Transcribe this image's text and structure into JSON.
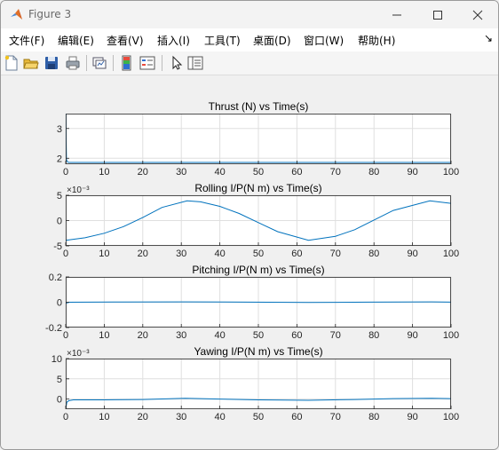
{
  "window": {
    "title": "Figure 3",
    "buttons": {
      "minimize": "minimize",
      "maximize": "maximize",
      "close": "close"
    }
  },
  "menu": [
    {
      "label": "文件(F)"
    },
    {
      "label": "编辑(E)"
    },
    {
      "label": "查看(V)"
    },
    {
      "label": "插入(I)"
    },
    {
      "label": "工具(T)"
    },
    {
      "label": "桌面(D)"
    },
    {
      "label": "窗口(W)"
    },
    {
      "label": "帮助(H)"
    }
  ],
  "menu_overflow_icon": "dock-arrow-icon",
  "toolbar": [
    {
      "icon": "new-figure-icon"
    },
    {
      "icon": "open-file-icon"
    },
    {
      "icon": "save-icon"
    },
    {
      "icon": "print-icon"
    },
    {
      "icon": "link-plot-icon"
    },
    {
      "icon": "insert-colorbar-icon"
    },
    {
      "icon": "insert-legend-icon"
    },
    {
      "icon": "edit-plot-pointer-icon"
    },
    {
      "icon": "property-inspector-icon"
    }
  ],
  "colors": {
    "line": "#0072bd",
    "grid": "#dfdfdf",
    "axes": "#262626"
  },
  "chart_data": [
    {
      "type": "line",
      "title": "Thrust (N) vs Time(s)",
      "xlabel": "",
      "ylabel": "",
      "xlim": [
        0,
        100
      ],
      "ylim": [
        1.8,
        3.5
      ],
      "xticks": [
        "0",
        "10",
        "20",
        "30",
        "40",
        "50",
        "60",
        "70",
        "80",
        "90",
        "100"
      ],
      "yticks": [
        "2",
        "3"
      ],
      "exponent_label": "",
      "grid": true,
      "x": [
        0,
        0.2,
        0.5,
        1,
        100
      ],
      "y": [
        3.5,
        1.95,
        1.87,
        1.86,
        1.86
      ]
    },
    {
      "type": "line",
      "title": "Rolling I/P(N m) vs Time(s)",
      "xlabel": "",
      "ylabel": "",
      "xlim": [
        0,
        100
      ],
      "ylim": [
        -0.005,
        0.005
      ],
      "xticks": [
        "0",
        "10",
        "20",
        "30",
        "40",
        "50",
        "60",
        "70",
        "80",
        "90",
        "100"
      ],
      "yticks": [
        "-5",
        "0",
        "5"
      ],
      "exponent_label": "×10⁻³",
      "grid": true,
      "x": [
        0,
        5,
        10,
        15,
        20,
        25,
        31.5,
        35,
        40,
        45,
        50,
        55,
        63,
        70,
        75,
        80,
        85,
        94.5,
        100
      ],
      "y": [
        -0.0039,
        -0.0034,
        -0.0025,
        -0.0012,
        0.0006,
        0.0026,
        0.0039,
        0.0037,
        0.0028,
        0.0014,
        -0.0004,
        -0.0022,
        -0.0039,
        -0.0031,
        -0.0018,
        0.0001,
        0.002,
        0.0039,
        0.0034
      ]
    },
    {
      "type": "line",
      "title": "Pitching I/P(N m) vs Time(s)",
      "xlabel": "",
      "ylabel": "",
      "xlim": [
        0,
        100
      ],
      "ylim": [
        -0.2,
        0.2
      ],
      "xticks": [
        "0",
        "10",
        "20",
        "30",
        "40",
        "50",
        "60",
        "70",
        "80",
        "90",
        "100"
      ],
      "yticks": [
        "-0.2",
        "0",
        "0.2"
      ],
      "exponent_label": "",
      "grid": true,
      "x": [
        0,
        1,
        15,
        31,
        47,
        63,
        79,
        95,
        100
      ],
      "y": [
        -0.008,
        0.0,
        0.002,
        0.003,
        0.001,
        -0.002,
        0.001,
        0.003,
        0.001
      ]
    },
    {
      "type": "line",
      "title": "Yawing I/P(N m) vs Time(s)",
      "xlabel": "",
      "ylabel": "",
      "xlim": [
        0,
        100
      ],
      "ylim": [
        -0.0025,
        0.01
      ],
      "xticks": [
        "0",
        "10",
        "20",
        "30",
        "40",
        "50",
        "60",
        "70",
        "80",
        "90",
        "100"
      ],
      "yticks": [
        "0",
        "5",
        "10"
      ],
      "exponent_label": "×10⁻³",
      "grid": true,
      "x": [
        0,
        0.3,
        0.8,
        2,
        10,
        20,
        31,
        40,
        50,
        63,
        75,
        85,
        95,
        100
      ],
      "y": [
        -0.0025,
        -0.0008,
        -0.0004,
        -0.0002,
        -0.0002,
        -0.0001,
        0.0002,
        0.0,
        -0.0002,
        -0.0003,
        -0.0001,
        0.0001,
        0.0002,
        0.0001
      ]
    }
  ]
}
